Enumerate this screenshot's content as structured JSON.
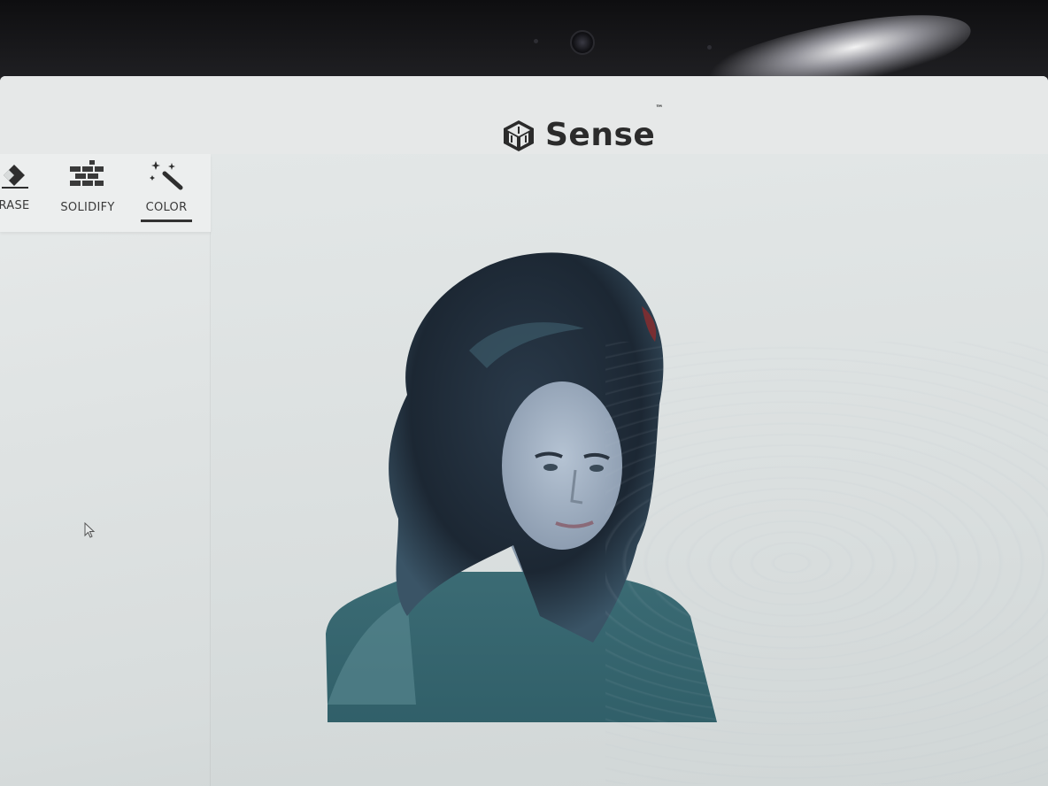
{
  "app": {
    "brand": "Sense",
    "trademark": "™"
  },
  "toolbar": {
    "tools": [
      {
        "label": "RASE",
        "icon": "eraser-icon"
      },
      {
        "label": "SOLIDIFY",
        "icon": "solidify-bricks-icon"
      },
      {
        "label": "COLOR",
        "icon": "magic-wand-icon",
        "active": true
      }
    ]
  },
  "colors": {
    "accent": "#333333",
    "screen_bg": "#e3e7e7",
    "bezel": "#161618"
  }
}
